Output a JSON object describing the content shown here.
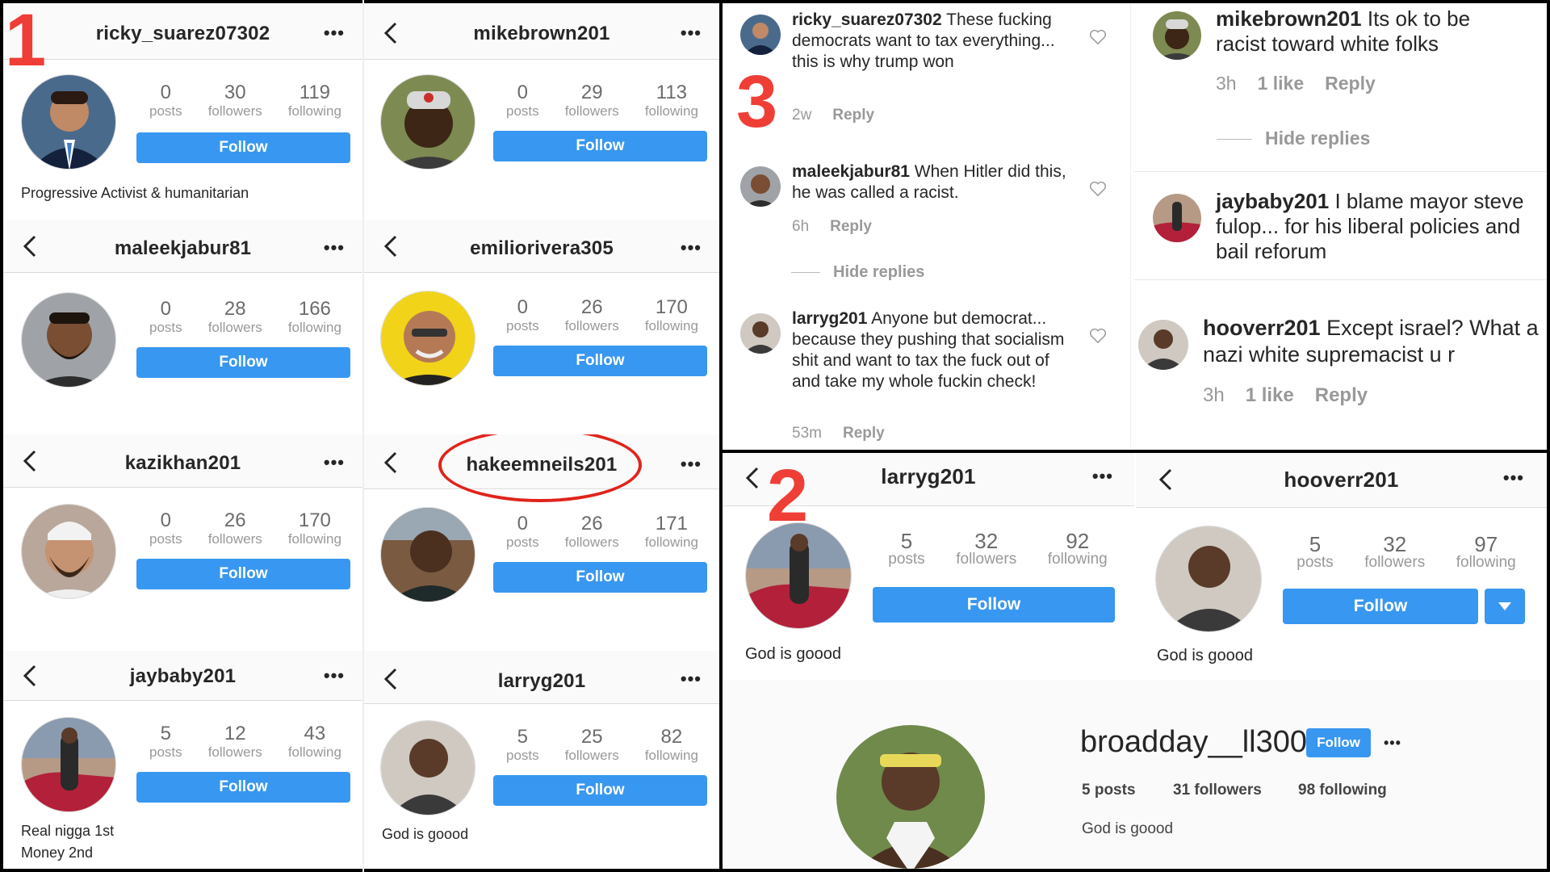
{
  "labels": {
    "posts": "posts",
    "followers": "followers",
    "following": "following",
    "follow": "Follow",
    "reply": "Reply",
    "hide_replies": "Hide replies",
    "more": "•••"
  },
  "markers": {
    "one": "1",
    "two": "2",
    "three": "3"
  },
  "profiles": [
    {
      "username": "ricky_suarez07302",
      "posts": "0",
      "followers": "30",
      "following": "119",
      "bio": "Progressive Activist & humanitarian"
    },
    {
      "username": "mikebrown201",
      "posts": "0",
      "followers": "29",
      "following": "113",
      "bio": ""
    },
    {
      "username": "maleekjabur81",
      "posts": "0",
      "followers": "28",
      "following": "166",
      "bio": ""
    },
    {
      "username": "emiliorivera305",
      "posts": "0",
      "followers": "26",
      "following": "170",
      "bio": ""
    },
    {
      "username": "kazikhan201",
      "posts": "0",
      "followers": "26",
      "following": "170",
      "bio": ""
    },
    {
      "username": "hakeemneils201",
      "posts": "0",
      "followers": "26",
      "following": "171",
      "bio": ""
    },
    {
      "username": "jaybaby201",
      "posts": "5",
      "followers": "12",
      "following": "43",
      "bio_line1": "Real nigga 1st",
      "bio_line2": "Money 2nd"
    },
    {
      "username": "larryg201",
      "posts": "5",
      "followers": "25",
      "following": "82",
      "bio": "God is goood"
    }
  ],
  "comments_left": [
    {
      "username": "ricky_suarez07302",
      "text": " These fucking democrats want to tax everything... this is why trump won",
      "time": "2w"
    },
    {
      "username": "maleekjabur81",
      "text": " When Hitler did this, he was called a racist.",
      "time": "6h"
    },
    {
      "username": "larryg201",
      "text": " Anyone but democrat... because they pushing that socialism shit and want to tax the fuck out of and take my whole fuckin check!",
      "time": "53m"
    }
  ],
  "comments_right": [
    {
      "username": "mikebrown201",
      "text": " Its ok to be racist toward white folks",
      "time": "3h",
      "likes": "1 like"
    },
    {
      "username": "jaybaby201",
      "text": " I blame mayor steve fulop... for his liberal policies and bail reforum"
    },
    {
      "username": "hooverr201",
      "text": " Except israel? What a nazi white supremacist u r",
      "time": "3h",
      "likes": "1 like"
    }
  ],
  "section2": [
    {
      "username": "larryg201",
      "posts": "5",
      "followers": "32",
      "following": "92",
      "bio": "God is goood"
    },
    {
      "username": "hooverr201",
      "posts": "5",
      "followers": "32",
      "following": "97",
      "bio": "God is goood"
    }
  ],
  "desktop_profile": {
    "username": "broadday__ll300",
    "follow": "Follow",
    "posts": "5 posts",
    "followers": "31 followers",
    "following": "98 following",
    "bio": "God is goood"
  },
  "colors": {
    "follow_blue": "#3897f0",
    "marker_red": "#ef3e36",
    "circle_red": "#e0241b"
  }
}
